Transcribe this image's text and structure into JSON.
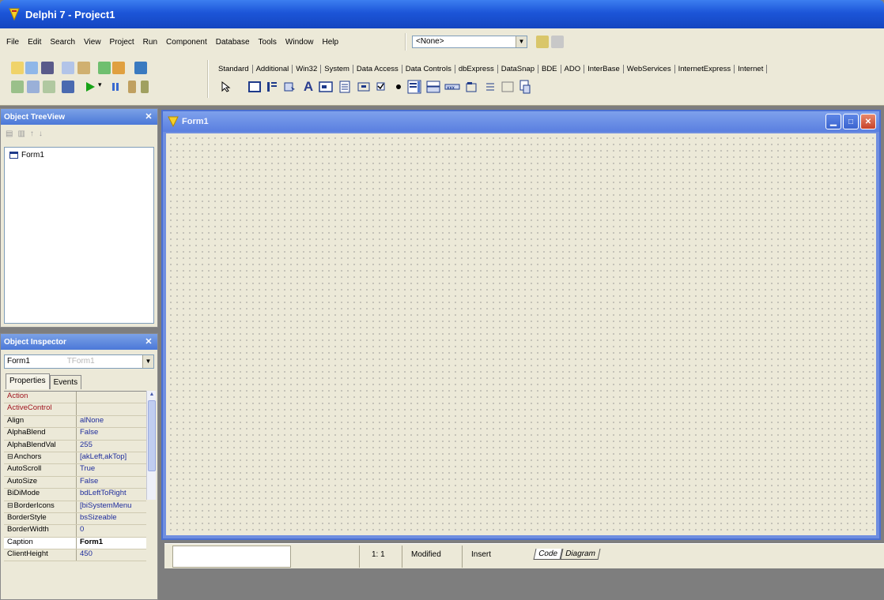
{
  "app": {
    "title": "Delphi 7 - Project1"
  },
  "menu": {
    "items": [
      "File",
      "Edit",
      "Search",
      "View",
      "Project",
      "Run",
      "Component",
      "Database",
      "Tools",
      "Window",
      "Help"
    ],
    "config_combo": "<None>"
  },
  "palette": {
    "tabs": [
      "Standard",
      "Additional",
      "Win32",
      "System",
      "Data Access",
      "Data Controls",
      "dbExpress",
      "DataSnap",
      "BDE",
      "ADO",
      "InterBase",
      "WebServices",
      "InternetExpress",
      "Internet"
    ],
    "components": [
      "pointer-icon",
      "frames-icon",
      "mainmenu-icon",
      "popupmenu-icon",
      "label-icon",
      "edit-icon",
      "memo-icon",
      "button-icon",
      "checkbox-icon",
      "radiobutton-icon",
      "listbox-icon",
      "combobox-icon",
      "scrollbar-icon",
      "groupbox-icon",
      "radiogroup-icon",
      "panel-icon",
      "actionlist-icon"
    ],
    "label_glyph": "A",
    "selected_tab": "Standard"
  },
  "treeview": {
    "title": "Object TreeView",
    "items": [
      "Form1"
    ]
  },
  "inspector": {
    "title": "Object Inspector",
    "selected_object": "Form1",
    "selected_object_class": "TForm1",
    "tabs": [
      "Properties",
      "Events"
    ],
    "properties": [
      {
        "name": "Action",
        "value": "",
        "kind": "event"
      },
      {
        "name": "ActiveControl",
        "value": "",
        "kind": "event"
      },
      {
        "name": "Align",
        "value": "alNone",
        "kind": "normal"
      },
      {
        "name": "AlphaBlend",
        "value": "False",
        "kind": "normal"
      },
      {
        "name": "AlphaBlendVal",
        "value": "255",
        "kind": "normal"
      },
      {
        "name": "Anchors",
        "value": "[akLeft,akTop]",
        "kind": "expand"
      },
      {
        "name": "AutoScroll",
        "value": "True",
        "kind": "normal"
      },
      {
        "name": "AutoSize",
        "value": "False",
        "kind": "normal"
      },
      {
        "name": "BiDiMode",
        "value": "bdLeftToRight",
        "kind": "normal"
      },
      {
        "name": "BorderIcons",
        "value": "[biSystemMenu",
        "kind": "expand"
      },
      {
        "name": "BorderStyle",
        "value": "bsSizeable",
        "kind": "normal"
      },
      {
        "name": "BorderWidth",
        "value": "0",
        "kind": "normal"
      },
      {
        "name": "Caption",
        "value": "Form1",
        "kind": "selected"
      },
      {
        "name": "ClientHeight",
        "value": "450",
        "kind": "normal"
      }
    ]
  },
  "designer": {
    "form_title": "Form1"
  },
  "status": {
    "position": "1: 1",
    "modified": "Modified",
    "insert": "Insert",
    "tabs": [
      "Code",
      "Diagram"
    ]
  },
  "colors": {
    "xp_titlebar": "#1c55d8",
    "form_border": "#4a6fd2",
    "close_button": "#c7432a"
  }
}
